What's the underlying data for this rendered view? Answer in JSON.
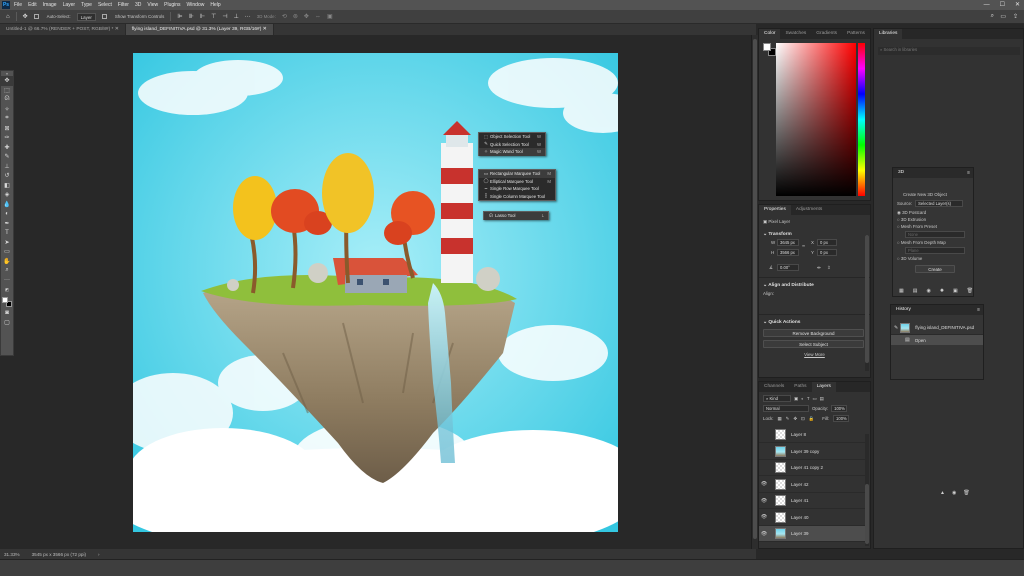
{
  "menubar": {
    "logo": "Ps",
    "items": [
      "File",
      "Edit",
      "Image",
      "Layer",
      "Type",
      "Select",
      "Filter",
      "3D",
      "View",
      "Plugins",
      "Window",
      "Help"
    ],
    "window_controls": [
      "—",
      "☐",
      "✕"
    ]
  },
  "options_bar": {
    "auto_select_label": "Auto-Select:",
    "auto_select_value": "Layer",
    "show_transform_label": "Show Transform Controls",
    "mode_3d_label": "3D Mode:",
    "more_label": "···"
  },
  "doc_tabs": [
    {
      "label": "Untitled-1 @ 66.7% (RENDER + POST, RGB/8#) *"
    },
    {
      "label": "flying island_DEFINITIVA.psd @ 31.3% (Layer 39, RGB/16#)"
    }
  ],
  "status": {
    "zoom": "31.33%",
    "doc_info": "3545 px x 3566 px (72 ppi)"
  },
  "color_panel": {
    "tabs": [
      "Color",
      "Swatches",
      "Gradients",
      "Patterns"
    ],
    "colors": {
      "hue_base": "#ff0000",
      "fg": "#ffffff",
      "bg": "#000000"
    }
  },
  "libraries_panel": {
    "tab": "Libraries",
    "search_placeholder": "Search in libraries"
  },
  "properties_panel": {
    "tabs": [
      "Properties",
      "Adjustments"
    ],
    "layer_type": "Pixel Layer",
    "transform_title": "Transform",
    "w_label": "W",
    "w_value": "3645 px",
    "h_label": "H",
    "h_value": "3566 px",
    "x_label": "X",
    "x_value": "0 px",
    "y_label": "Y",
    "y_value": "0 px",
    "angle_value": "0.00°",
    "align_title": "Align and Distribute",
    "align_label": "Align:",
    "quick_actions_title": "Quick Actions",
    "remove_bg": "Remove Background",
    "select_subject": "Select Subject",
    "view_more": "View More"
  },
  "layers_panel": {
    "tabs": [
      "Channels",
      "Paths",
      "Layers"
    ],
    "kind_label": "Kind",
    "blend_mode": "Normal",
    "opacity_label": "Opacity:",
    "opacity_value": "100%",
    "lock_label": "Lock:",
    "fill_label": "Fill:",
    "fill_value": "100%",
    "layers": [
      {
        "name": "Layer 8",
        "visible": false,
        "thumb": "transparent"
      },
      {
        "name": "Layer 39 copy",
        "visible": false,
        "thumb": "image"
      },
      {
        "name": "Layer 41 copy 2",
        "visible": false,
        "thumb": "transparent"
      },
      {
        "name": "Layer 42",
        "visible": true,
        "thumb": "transparent"
      },
      {
        "name": "Layer 41",
        "visible": true,
        "thumb": "transparent"
      },
      {
        "name": "Layer 40",
        "visible": true,
        "thumb": "transparent"
      },
      {
        "name": "Layer 39",
        "visible": true,
        "thumb": "image",
        "selected": true
      }
    ]
  },
  "panel_3d": {
    "title": "3D",
    "create_label": "Create New 3D Object",
    "source_label": "Source:",
    "source_value": "Selected Layer(s)",
    "options": [
      "3D Postcard",
      "3D Extrusion",
      "Mesh From Preset",
      "Mesh From Depth Map",
      "3D Volume"
    ],
    "preset_value": "None",
    "depth_value": "Plane",
    "create_button": "Create"
  },
  "history_panel": {
    "title": "History",
    "snapshot": "flying island_DEFINITIVA.psd",
    "items": [
      "Open"
    ]
  },
  "tool_flyouts": {
    "selection": [
      {
        "label": "Object Selection Tool",
        "key": "W"
      },
      {
        "label": "Quick Selection Tool",
        "key": "W"
      },
      {
        "label": "Magic Wand Tool",
        "key": "W"
      }
    ],
    "marquee": [
      {
        "label": "Rectangular Marquee Tool",
        "key": "M"
      },
      {
        "label": "Elliptical Marquee Tool",
        "key": "M"
      },
      {
        "label": "Single Row Marquee Tool",
        "key": ""
      },
      {
        "label": "Single Column Marquee Tool",
        "key": ""
      }
    ],
    "lasso": [
      {
        "label": "Lasso Tool",
        "key": "L"
      }
    ]
  }
}
